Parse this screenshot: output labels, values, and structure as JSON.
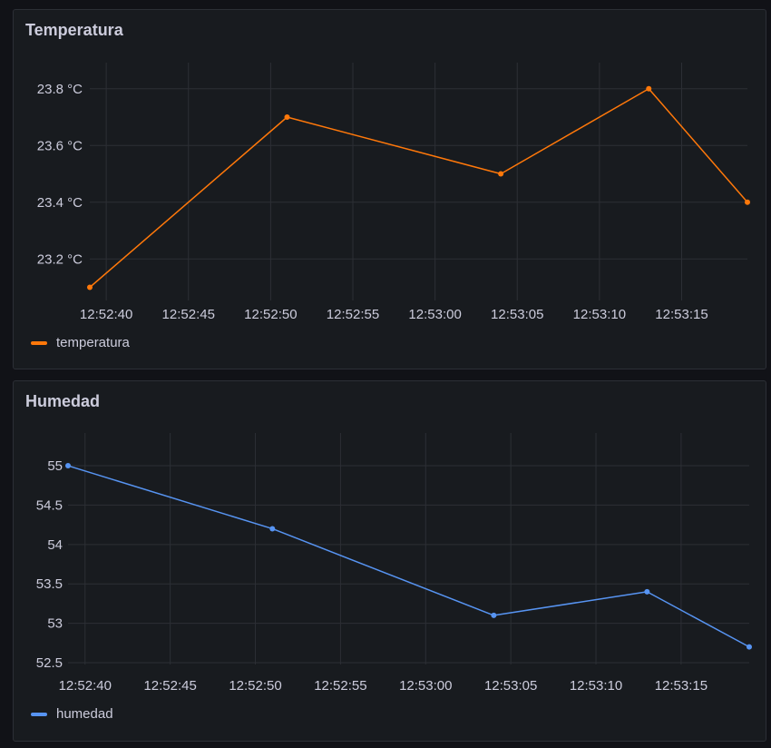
{
  "chart_data": [
    {
      "type": "line",
      "title": "Temperatura",
      "x": [
        "12:52:39",
        "12:52:51",
        "12:53:04",
        "12:53:13",
        "12:53:19"
      ],
      "series": [
        {
          "name": "temperatura",
          "values": [
            23.1,
            23.7,
            23.5,
            23.8,
            23.4
          ],
          "color": "#ff780a"
        }
      ],
      "xlim": [
        "12:52:39",
        "12:53:19"
      ],
      "xticks": [
        "12:52:40",
        "12:52:45",
        "12:52:50",
        "12:52:55",
        "12:53:00",
        "12:53:05",
        "12:53:10",
        "12:53:15"
      ],
      "ylim": [
        23.06,
        23.86
      ],
      "yticks": [
        23.2,
        23.4,
        23.6,
        23.8
      ],
      "ytick_labels": [
        "23.2 °C",
        "23.4 °C",
        "23.6 °C",
        "23.8 °C"
      ],
      "grid": true,
      "legend": "bottom-left"
    },
    {
      "type": "line",
      "title": "Humedad",
      "x": [
        "12:52:39",
        "12:52:51",
        "12:53:04",
        "12:53:13",
        "12:53:19"
      ],
      "series": [
        {
          "name": "humedad",
          "values": [
            55.0,
            54.2,
            53.1,
            53.4,
            52.7
          ],
          "color": "#5794f2"
        }
      ],
      "xlim": [
        "12:52:39",
        "12:53:19"
      ],
      "xticks": [
        "12:52:40",
        "12:52:45",
        "12:52:50",
        "12:52:55",
        "12:53:00",
        "12:53:05",
        "12:53:10",
        "12:53:15"
      ],
      "ylim": [
        52.5,
        55.3
      ],
      "yticks": [
        52.5,
        53,
        53.5,
        54,
        54.5,
        55
      ],
      "ytick_labels": [
        "52.5",
        "53",
        "53.5",
        "54",
        "54.5",
        "55"
      ],
      "grid": true,
      "legend": "bottom-left"
    }
  ]
}
